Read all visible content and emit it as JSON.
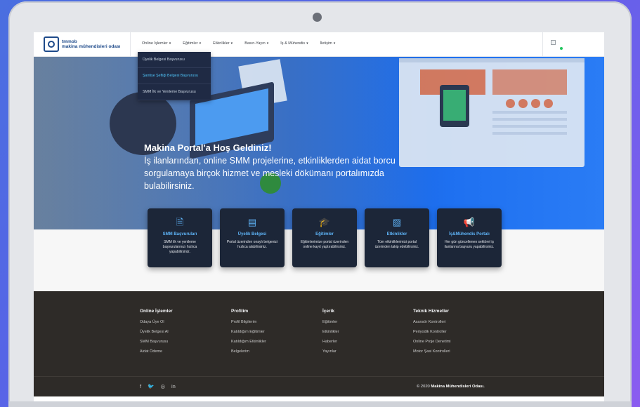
{
  "header": {
    "logo_line1": "tmmob",
    "logo_line2": "makina mühendisleri odası",
    "nav": [
      {
        "label": "Online İşlemler"
      },
      {
        "label": "Eğitimler"
      },
      {
        "label": "Etkinlikler"
      },
      {
        "label": "Basın-Yayın"
      },
      {
        "label": "İş & Mühendis"
      },
      {
        "label": "İletişim"
      }
    ]
  },
  "dropdown": {
    "items": [
      {
        "label": "Üyelik Belgesi Başvurusu"
      },
      {
        "label": "Şantiye Şefliği Belgesi Başvurusu"
      },
      {
        "label": "SMM İlk ve Yenileme Başvurusu"
      }
    ]
  },
  "hero": {
    "title": "Makina Portal'a Hoş Geldiniz!",
    "subtitle": "İş ilanlarından, online SMM projelerine, etkinliklerden aidat borcu sorgulamaya birçok hizmet ve mesleki dökümanı portalımızda bulabilirsiniz."
  },
  "cards": [
    {
      "icon": "document-code-icon",
      "title": "SMM Başvuruları",
      "desc": "SMM ilk ve yenileme başvurularınızı hızlıca yapabilirsiniz."
    },
    {
      "icon": "certificate-icon",
      "title": "Üyelik Belgesi",
      "desc": "Portal üzerinden onaylı belgenizi hızlıca alabilirsiniz."
    },
    {
      "icon": "graduation-cap-icon",
      "title": "Eğitimler",
      "desc": "Eğitimlerimize portal üzerinden online kayıt yaptırabilirsiniz."
    },
    {
      "icon": "image-icon",
      "title": "Etkinlikler",
      "desc": "Tüm etkinliklerimizi portal üzerinden takip edebilirsiniz."
    },
    {
      "icon": "megaphone-icon",
      "title": "İş&Mühendis Portalı",
      "desc": "Her gün güncellenen sektörel iş ilanlarına başvuru yapabilirsiniz."
    }
  ],
  "footer": {
    "columns": [
      {
        "title": "Online İşlemler",
        "links": [
          "Odaya Üye Ol",
          "Üyelik Belgesi Al",
          "SMM Başvurusu",
          "Aidat Ödeme"
        ]
      },
      {
        "title": "Profilim",
        "links": [
          "Profil Bilgilerim",
          "Katıldığım Eğitimler",
          "Katıldığım Etkinlikler",
          "Belgelerim"
        ]
      },
      {
        "title": "İçerik",
        "links": [
          "Eğitimler",
          "Etkinlikler",
          "Haberler",
          "Yayınlar"
        ]
      },
      {
        "title": "Teknik Hizmetler",
        "links": [
          "Asansör Kontrolleri",
          "Periyodik Kontroller",
          "Online Proje Denetimi",
          "Motor Şasi Kontrolleri"
        ]
      }
    ],
    "social": [
      "f",
      "🐦",
      "◎",
      "in"
    ],
    "copyright_prefix": "© 2020",
    "copyright_org": "Makina Mühendisleri Odası."
  },
  "colors": {
    "accent": "#5eb3f6",
    "card_bg": "#1c2638",
    "footer_bg": "#2e2b28",
    "dropdown_bg": "#1f2a44",
    "logo_blue": "#1e4a8a"
  }
}
